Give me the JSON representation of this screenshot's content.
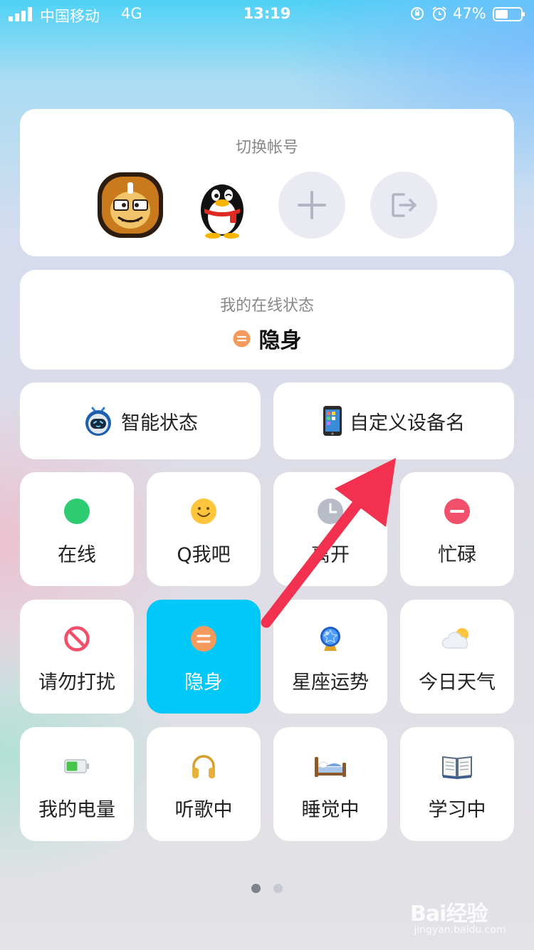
{
  "status_bar": {
    "carrier": "中国移动",
    "network": "4G",
    "time": "13:19",
    "battery": "47%"
  },
  "account_switcher": {
    "title": "切换帐号",
    "accounts": [
      {
        "name": "lion-avatar-icon"
      },
      {
        "name": "penguin-avatar-icon"
      }
    ],
    "add_icon": "plus-icon",
    "logout_icon": "logout-icon"
  },
  "online_status": {
    "label": "我的在线状态",
    "value": "隐身",
    "dot_color": "#f39a5c"
  },
  "quick_actions": [
    {
      "label": "智能状态",
      "icon": "robot-icon"
    },
    {
      "label": "自定义设备名",
      "icon": "phone-icon"
    }
  ],
  "statuses": [
    {
      "label": "在线",
      "icon": "green-dot-icon"
    },
    {
      "label": "Q我吧",
      "icon": "smile-icon"
    },
    {
      "label": "离开",
      "icon": "clock-icon"
    },
    {
      "label": "忙碌",
      "icon": "busy-icon"
    },
    {
      "label": "请勿打扰",
      "icon": "no-disturb-icon"
    },
    {
      "label": "隐身",
      "icon": "invisible-icon",
      "selected": true
    },
    {
      "label": "星座运势",
      "icon": "crystal-ball-icon"
    },
    {
      "label": "今日天气",
      "icon": "weather-icon"
    },
    {
      "label": "我的电量",
      "icon": "battery-icon"
    },
    {
      "label": "听歌中",
      "icon": "headphones-icon"
    },
    {
      "label": "睡觉中",
      "icon": "bed-icon"
    },
    {
      "label": "学习中",
      "icon": "book-icon"
    }
  ],
  "pagination": {
    "current": 1,
    "total": 2
  },
  "colors": {
    "selected": "#00c8f8",
    "arrow": "#f2304f",
    "online": "#2ecc71",
    "busy": "#f2506a"
  },
  "watermark": {
    "main": "Bai经验",
    "sub": "jingyan.baidu.com"
  }
}
